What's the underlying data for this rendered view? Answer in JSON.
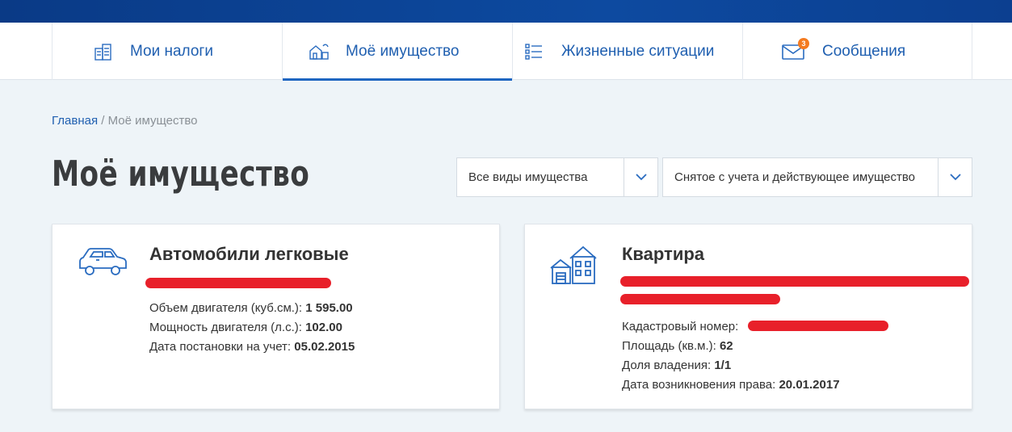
{
  "nav": {
    "tabs": [
      {
        "label": "Мои налоги",
        "icon": "tax-documents-icon"
      },
      {
        "label": "Моё имущество",
        "icon": "property-icon",
        "active": true
      },
      {
        "label": "Жизненные ситуации",
        "icon": "list-icon"
      },
      {
        "label": "Сообщения",
        "icon": "envelope-icon",
        "badge": "3"
      }
    ]
  },
  "breadcrumb": {
    "home": "Главная",
    "separator": " / ",
    "current": "Моё имущество"
  },
  "page": {
    "title": "Моё имущество"
  },
  "filters": {
    "type": {
      "value": "Все виды имущества"
    },
    "status": {
      "value": "Снятое с учета и действующее имущество"
    }
  },
  "cards": [
    {
      "title": "Автомобили легковые",
      "icon": "car-icon",
      "fields": [
        {
          "label": "Объем двигателя (куб.см.): ",
          "value": "1 595.00"
        },
        {
          "label": "Мощность двигателя (л.с.): ",
          "value": "102.00"
        },
        {
          "label": "Дата постановки на учет: ",
          "value": "05.02.2015"
        }
      ]
    },
    {
      "title": "Квартира",
      "icon": "house-icon",
      "fields": [
        {
          "label": "Кадастровый номер: ",
          "value": ""
        },
        {
          "label": "Площадь (кв.м.): ",
          "value": "62"
        },
        {
          "label": "Доля владения: ",
          "value": "1/1"
        },
        {
          "label": "Дата возникновения права: ",
          "value": "20.01.2017"
        }
      ]
    }
  ],
  "colors": {
    "accent": "#1f5fb0",
    "badge": "#f47b20",
    "redaction": "#e8202a"
  }
}
